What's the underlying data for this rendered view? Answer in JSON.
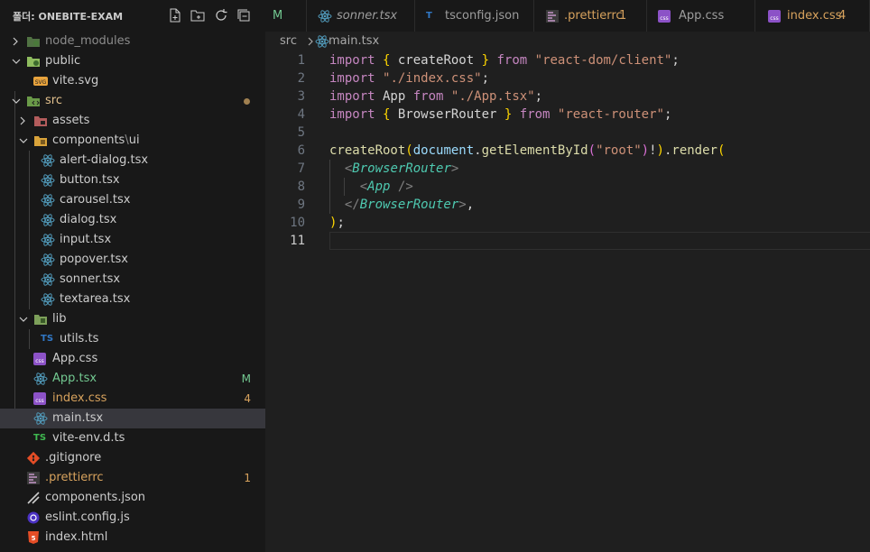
{
  "explorer": {
    "title": "폴더: ONEBITE-EXAM",
    "items": [
      {
        "label": "node_modules",
        "badge": ""
      },
      {
        "label": "public",
        "badge": ""
      },
      {
        "label": "vite.svg",
        "badge": ""
      },
      {
        "label": "src",
        "badge": ""
      },
      {
        "label": "assets",
        "badge": ""
      },
      {
        "label": "components",
        "label2": "ui",
        "badge": ""
      },
      {
        "label": "alert-dialog.tsx",
        "badge": ""
      },
      {
        "label": "button.tsx",
        "badge": ""
      },
      {
        "label": "carousel.tsx",
        "badge": ""
      },
      {
        "label": "dialog.tsx",
        "badge": ""
      },
      {
        "label": "input.tsx",
        "badge": ""
      },
      {
        "label": "popover.tsx",
        "badge": ""
      },
      {
        "label": "sonner.tsx",
        "badge": ""
      },
      {
        "label": "textarea.tsx",
        "badge": ""
      },
      {
        "label": "lib",
        "badge": ""
      },
      {
        "label": "utils.ts",
        "badge": ""
      },
      {
        "label": "App.css",
        "badge": ""
      },
      {
        "label": "App.tsx",
        "badge": "M"
      },
      {
        "label": "index.css",
        "badge": "4"
      },
      {
        "label": "main.tsx",
        "badge": ""
      },
      {
        "label": "vite-env.d.ts",
        "badge": ""
      },
      {
        "label": ".gitignore",
        "badge": ""
      },
      {
        "label": ".prettierrc",
        "badge": "1"
      },
      {
        "label": "components.json",
        "badge": ""
      },
      {
        "label": "eslint.config.js",
        "badge": ""
      },
      {
        "label": "index.html",
        "badge": ""
      }
    ]
  },
  "tabs": [
    {
      "label": "M",
      "badge": ""
    },
    {
      "label": "sonner.tsx",
      "badge": ""
    },
    {
      "label": "tsconfig.json",
      "badge": ""
    },
    {
      "label": ".prettierrc",
      "badge": "1"
    },
    {
      "label": "App.css",
      "badge": ""
    },
    {
      "label": "index.css",
      "badge": "4"
    }
  ],
  "breadcrumb": {
    "folder": "src",
    "file": "main.tsx"
  },
  "editor": {
    "line_numbers": [
      "1",
      "2",
      "3",
      "4",
      "5",
      "6",
      "7",
      "8",
      "9",
      "10",
      "11"
    ],
    "lines": [
      "import { createRoot } from \"react-dom/client\";",
      "import \"./index.css\";",
      "import App from \"./App.tsx\";",
      "import { BrowserRouter } from \"react-router\";",
      "",
      "createRoot(document.getElementById(\"root\")!).render(",
      "  <BrowserRouter>",
      "    <App />",
      "  </BrowserRouter>,",
      ");",
      ""
    ]
  },
  "colors": {
    "modified": "#e2c08d",
    "error": "#d7a25d",
    "folder_green": "#8fbc5f",
    "react_blue": "#519aba",
    "ts_blue": "#3178c6",
    "css_purple": "#8c52c7"
  }
}
